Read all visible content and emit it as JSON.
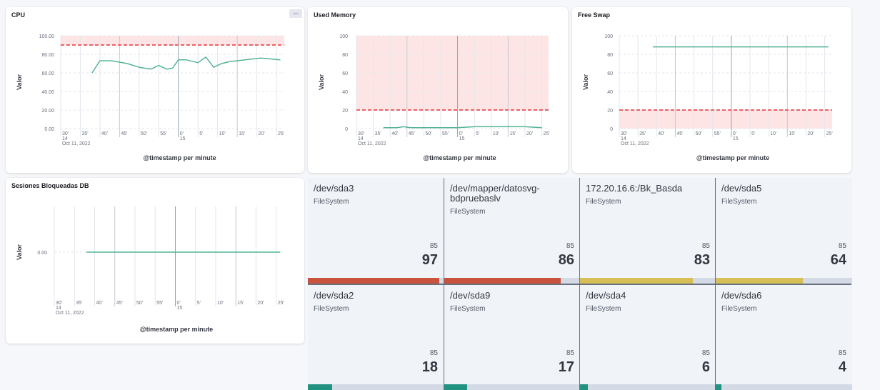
{
  "colors": {
    "line": "#54b399",
    "threshold": "#e7323c",
    "thresholdFill": "#fde5e5",
    "grid": "#e3e6eb",
    "red": "#c9523d",
    "yellow": "#d6bf57",
    "green": "#209280"
  },
  "cpu": {
    "title": "CPU",
    "menu_icon": "ellipsis-icon",
    "chart_data": {
      "type": "line",
      "ylabel": "Valor",
      "xlabel": "@timestamp per minute",
      "ylim": [
        0,
        100
      ],
      "yticks": [
        "100.00",
        "80.00",
        "60.00",
        "40.00",
        "20.00",
        "0.00"
      ],
      "xticks": [
        "30'",
        "35'",
        "40'",
        "45'",
        "50'",
        "55'",
        "0'",
        "5'",
        "10'",
        "15'",
        "20'",
        "25'"
      ],
      "xsub": [
        "14",
        "Oct 11, 2022",
        "15"
      ],
      "threshold": 90,
      "threshold_region": "above",
      "x": [
        38,
        40,
        43,
        47,
        50,
        53,
        55,
        57,
        58.5,
        60,
        62,
        65,
        67,
        69,
        71,
        73,
        77,
        81,
        86
      ],
      "values": [
        60,
        73,
        73,
        70,
        66,
        64,
        68,
        64,
        65,
        74,
        74,
        71,
        77,
        66,
        70,
        72,
        74,
        76,
        74
      ]
    }
  },
  "memory": {
    "title": "Used Memory",
    "chart_data": {
      "type": "line",
      "ylabel": "Valor",
      "xlabel": "@timestamp per minute",
      "ylim": [
        0,
        100
      ],
      "yticks": [
        "100",
        "80",
        "60",
        "40",
        "20",
        "0"
      ],
      "xticks": [
        "30'",
        "35'",
        "40'",
        "45'",
        "50'",
        "55'",
        "0'",
        "5'",
        "10'",
        "15'",
        "20'",
        "25'"
      ],
      "xsub": [
        "14",
        "Oct 11, 2022",
        "15"
      ],
      "threshold": 20,
      "threshold_region": "above",
      "x": [
        38,
        42,
        44,
        46,
        50,
        55,
        60,
        65,
        70,
        75,
        80,
        85
      ],
      "values": [
        1,
        1,
        2,
        1,
        1,
        1,
        1,
        2,
        2,
        2,
        2,
        1
      ]
    }
  },
  "swap": {
    "title": "Free Swap",
    "chart_data": {
      "type": "line",
      "ylabel": "Valor",
      "xlabel": "@timestamp per minute",
      "ylim": [
        0,
        100
      ],
      "yticks": [
        "100",
        "80",
        "60",
        "40",
        "20",
        "0"
      ],
      "xticks": [
        "30'",
        "35'",
        "40'",
        "45'",
        "50'",
        "55'",
        "0'",
        "5'",
        "10'",
        "15'",
        "20'",
        "25'"
      ],
      "xsub": [
        "14",
        "Oct 11, 2022",
        "15"
      ],
      "threshold": 20,
      "threshold_region": "below",
      "x": [
        39,
        86
      ],
      "values": [
        88,
        88
      ]
    }
  },
  "sessions": {
    "title": "Sesiones Bloqueadas DB",
    "chart_data": {
      "type": "line",
      "ylabel": "Valor",
      "xlabel": "@timestamp per minute",
      "yticks": [
        "0.00"
      ],
      "xticks": [
        "30'",
        "35'",
        "40'",
        "45'",
        "50'",
        "55'",
        "0'",
        "5'",
        "10'",
        "15'",
        "20'",
        "25'"
      ],
      "xsub": [
        "14",
        "Oct 11, 2022",
        "15"
      ],
      "x": [
        38,
        86
      ],
      "values": [
        0,
        0
      ]
    }
  },
  "filesystems": [
    {
      "name": "/dev/sda3",
      "type": "FileSystem",
      "goal": "85",
      "value": "97",
      "pct": 97,
      "status": "red"
    },
    {
      "name": "/dev/mapper/datosvg-\nbdpruebaslv",
      "type": "FileSystem",
      "goal": "85",
      "value": "86",
      "pct": 86,
      "status": "red"
    },
    {
      "name": "172.20.16.6:/Bk_Basda",
      "type": "FileSystem",
      "goal": "85",
      "value": "83",
      "pct": 83,
      "status": "yellow"
    },
    {
      "name": "/dev/sda5",
      "type": "FileSystem",
      "goal": "85",
      "value": "64",
      "pct": 64,
      "status": "yellow"
    },
    {
      "name": "/dev/sda2",
      "type": "FileSystem",
      "goal": "85",
      "value": "18",
      "pct": 18,
      "status": "green"
    },
    {
      "name": "/dev/sda9",
      "type": "FileSystem",
      "goal": "85",
      "value": "17",
      "pct": 17,
      "status": "green"
    },
    {
      "name": "/dev/sda4",
      "type": "FileSystem",
      "goal": "85",
      "value": "6",
      "pct": 6,
      "status": "green"
    },
    {
      "name": "/dev/sda6",
      "type": "FileSystem",
      "goal": "85",
      "value": "4",
      "pct": 4,
      "status": "green"
    }
  ]
}
